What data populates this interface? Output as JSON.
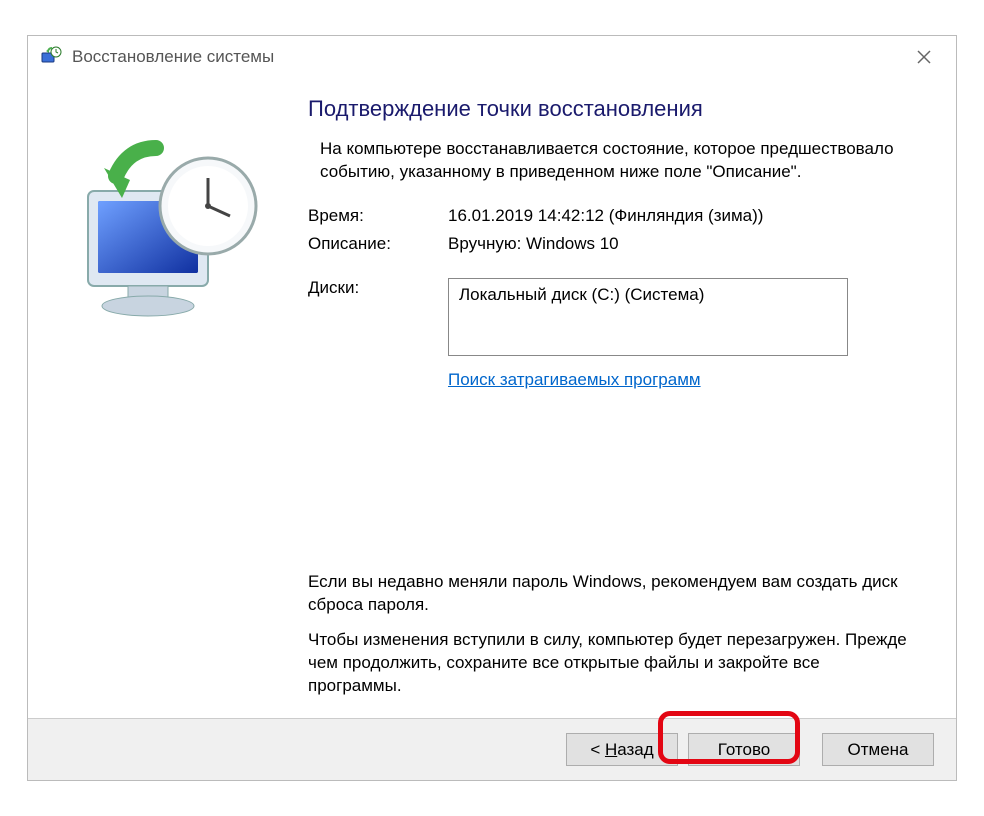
{
  "titlebar": {
    "title": "Восстановление системы"
  },
  "main": {
    "heading": "Подтверждение точки восстановления",
    "intro": "На компьютере восстанавливается состояние, которое предшествовало событию, указанному в приведенном ниже поле \"Описание\".",
    "fields": {
      "time_label": "Время:",
      "time_value": "16.01.2019 14:42:12 (Финляндия (зима))",
      "desc_label": "Описание:",
      "desc_value": "Вручную: Windows 10",
      "disks_label": "Диски:",
      "disks_value": "Локальный диск (C:) (Система)"
    },
    "link": "Поиск затрагиваемых программ",
    "footer1": "Если вы недавно меняли пароль Windows, рекомендуем вам создать диск сброса пароля.",
    "footer2": "Чтобы изменения вступили в силу, компьютер будет перезагружен. Прежде чем продолжить, сохраните все открытые файлы и закройте все программы."
  },
  "buttons": {
    "back_prefix": "< ",
    "back_letter": "Н",
    "back_rest": "азад",
    "finish": "Готово",
    "cancel": "Отмена"
  }
}
